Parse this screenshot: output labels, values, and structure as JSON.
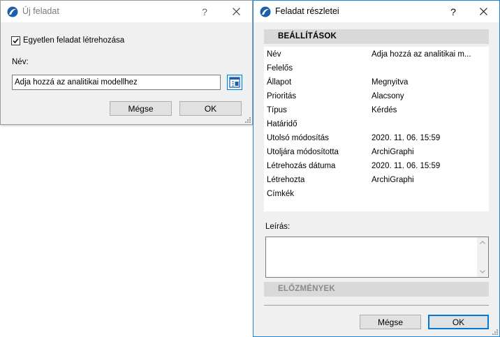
{
  "new_task_dialog": {
    "title": "Új feladat",
    "help": "?",
    "close": "✕",
    "single_task_checked": true,
    "single_task_label": "Egyetlen feladat létrehozása",
    "name_label": "Név:",
    "name_value": "Adja hozzá az analitikai modellhez",
    "cancel_label": "Mégse",
    "ok_label": "OK"
  },
  "task_details_dialog": {
    "title": "Feladat részletei",
    "help": "?",
    "close": "✕",
    "settings_header": "BEÁLLÍTÁSOK",
    "properties": [
      {
        "key": "Név",
        "value": "Adja hozzá az analitikai m..."
      },
      {
        "key": "Felelős",
        "value": ""
      },
      {
        "key": "Állapot",
        "value": "Megnyitva"
      },
      {
        "key": "Prioritás",
        "value": "Alacsony"
      },
      {
        "key": "Típus",
        "value": "Kérdés"
      },
      {
        "key": "Határidő",
        "value": ""
      },
      {
        "key": "Utolsó módosítás",
        "value": "2020. 11. 06. 15:59"
      },
      {
        "key": "Utoljára módosította",
        "value": "ArchiGraphi"
      },
      {
        "key": "Létrehozás dátuma",
        "value": "2020. 11. 06. 15:59"
      },
      {
        "key": "Létrehozta",
        "value": "ArchiGraphi"
      },
      {
        "key": "Címkék",
        "value": ""
      }
    ],
    "description_label": "Leírás:",
    "description_value": "",
    "history_header": "ELŐZMÉNYEK",
    "cancel_label": "Mégse",
    "ok_label": "OK"
  },
  "colors": {
    "accent": "#0078d7",
    "app_icon": "#1d5fa8",
    "section_header": "#d9d9d9",
    "button_face": "#e1e1e1"
  },
  "icons": {
    "app": "archicad-logo-icon",
    "name_picker": "list-picker-icon",
    "settings_toggle": "triangle-down-icon",
    "history_toggle": "triangle-right-icon"
  }
}
